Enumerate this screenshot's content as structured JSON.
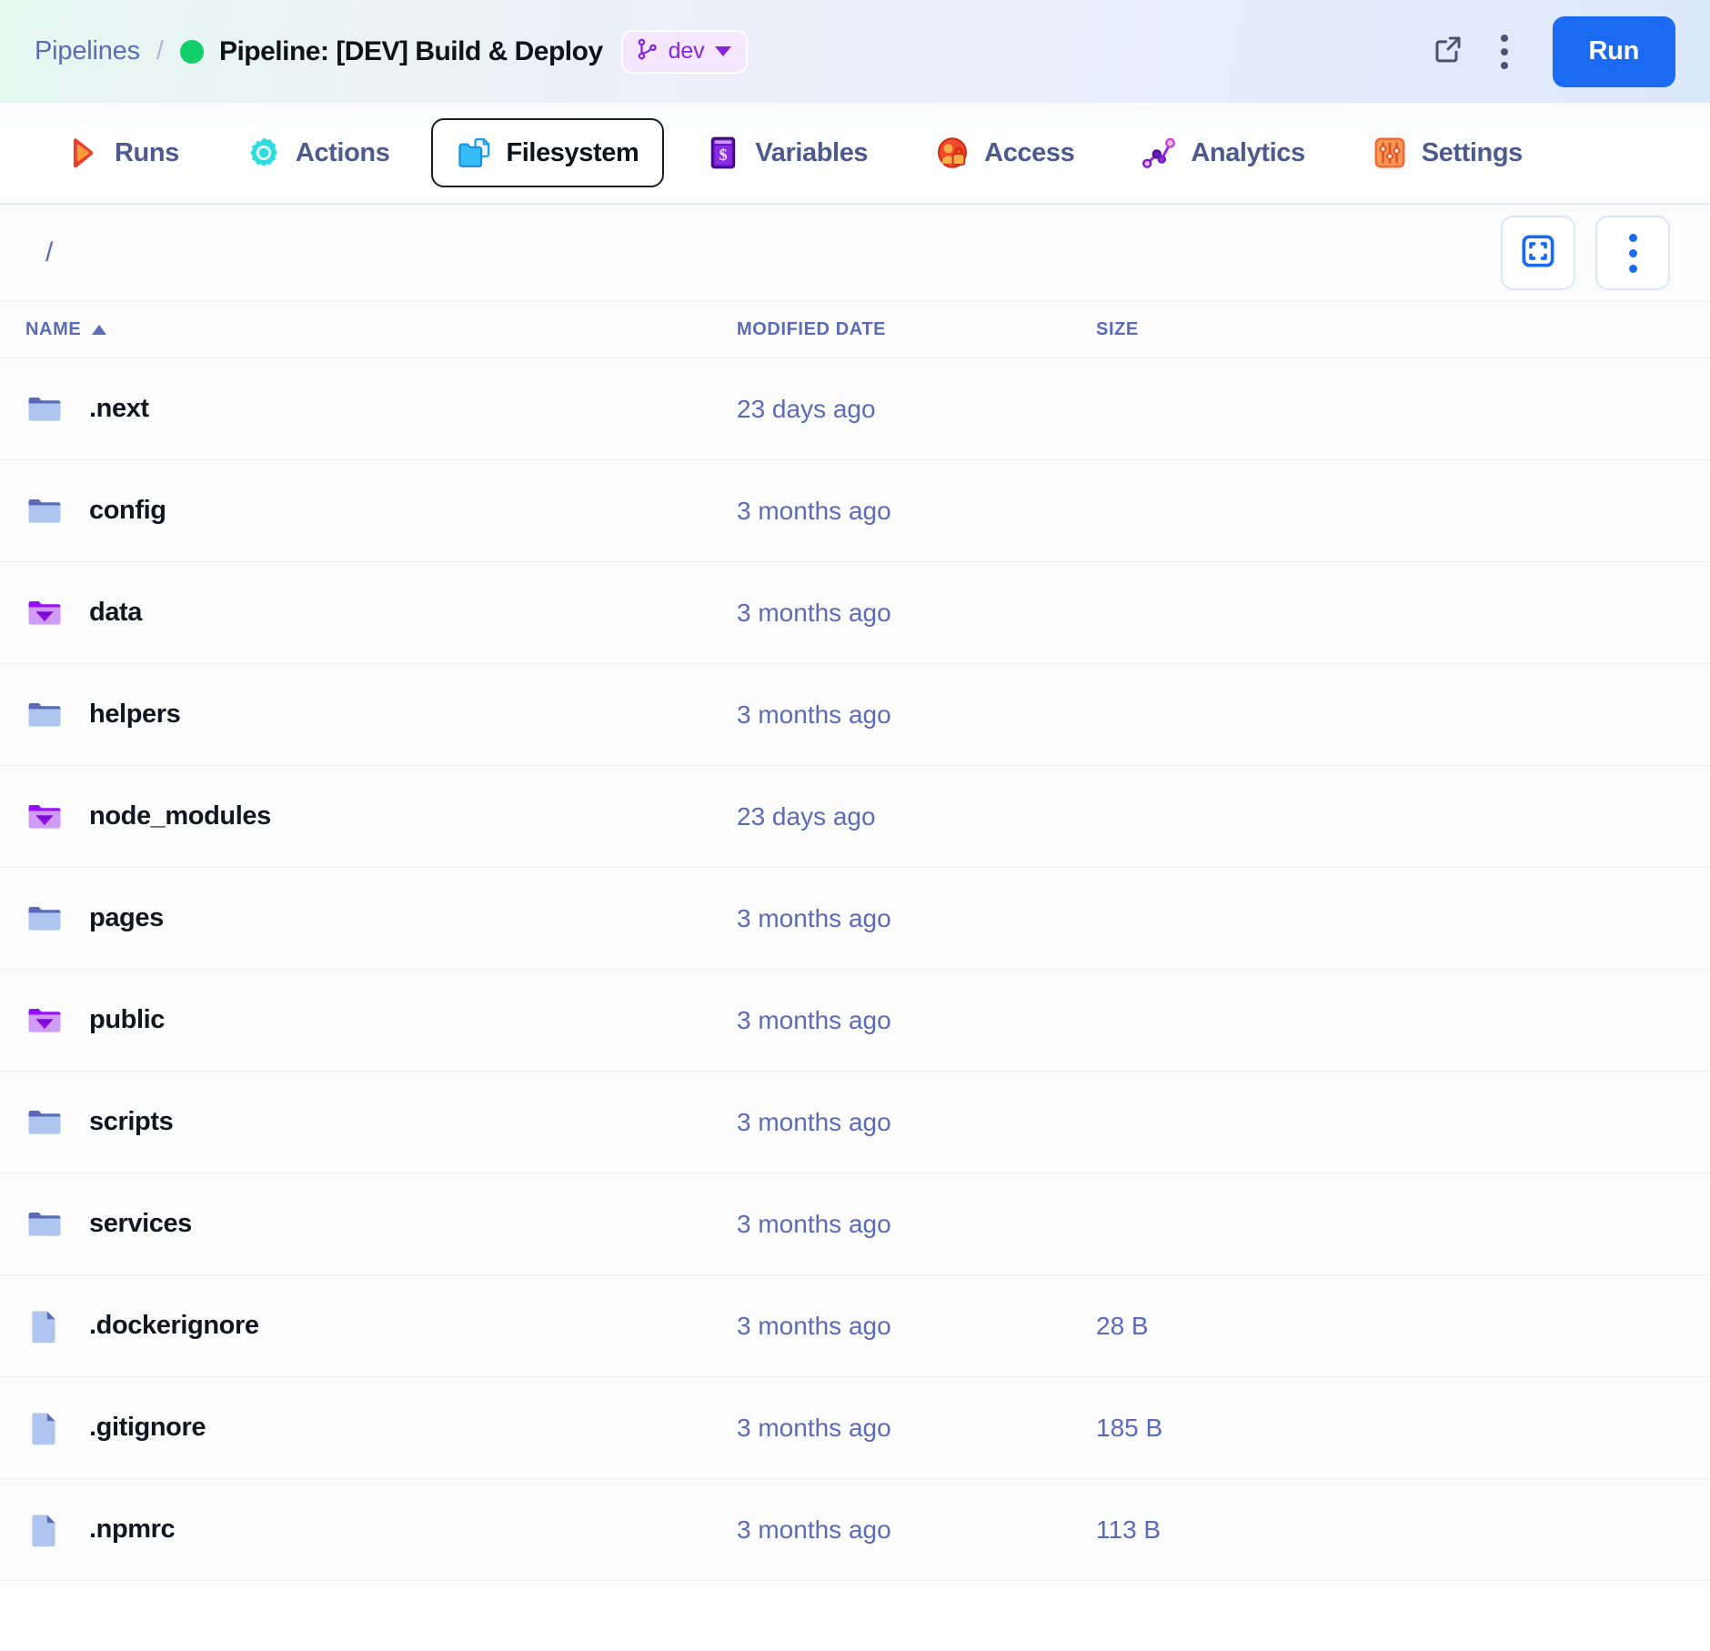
{
  "header": {
    "breadcrumb_root": "Pipelines",
    "breadcrumb_separator": "/",
    "status": "running",
    "title": "Pipeline: [DEV] Build & Deploy",
    "env_badge": {
      "label": "dev",
      "icon": "git-branch-icon"
    },
    "actions": {
      "open_external_icon": "external-link-icon",
      "more_icon": "kebab-menu-icon",
      "run_label": "Run"
    },
    "colors": {
      "accent": "#1a6bf2",
      "status_dot": "#12cf6a",
      "env_text": "#8426e0",
      "env_bg": "#f3e6fd"
    }
  },
  "tabs": [
    {
      "label": "Runs",
      "icon": "play-icon",
      "active": false
    },
    {
      "label": "Actions",
      "icon": "gear-icon",
      "active": false
    },
    {
      "label": "Filesystem",
      "icon": "folder-file-icon",
      "active": true
    },
    {
      "label": "Variables",
      "icon": "dollar-book-icon",
      "active": false
    },
    {
      "label": "Access",
      "icon": "user-lock-icon",
      "active": false
    },
    {
      "label": "Analytics",
      "icon": "graph-nodes-icon",
      "active": false
    },
    {
      "label": "Settings",
      "icon": "sliders-icon",
      "active": false
    }
  ],
  "toolbar": {
    "path": "/",
    "fullscreen_icon": "fullscreen-icon",
    "more_icon": "kebab-menu-icon"
  },
  "table": {
    "columns": [
      {
        "key": "name",
        "label": "NAME",
        "sorted": "asc"
      },
      {
        "key": "date",
        "label": "MODIFIED DATE",
        "sorted": null
      },
      {
        "key": "size",
        "label": "SIZE",
        "sorted": null
      }
    ],
    "rows": [
      {
        "name": ".next",
        "icon": "folder-icon",
        "date": "23 days ago",
        "size": ""
      },
      {
        "name": "config",
        "icon": "folder-icon",
        "date": "3 months ago",
        "size": ""
      },
      {
        "name": "data",
        "icon": "folder-gem-icon",
        "date": "3 months ago",
        "size": ""
      },
      {
        "name": "helpers",
        "icon": "folder-icon",
        "date": "3 months ago",
        "size": ""
      },
      {
        "name": "node_modules",
        "icon": "folder-gem-icon",
        "date": "23 days ago",
        "size": ""
      },
      {
        "name": "pages",
        "icon": "folder-icon",
        "date": "3 months ago",
        "size": ""
      },
      {
        "name": "public",
        "icon": "folder-gem-icon",
        "date": "3 months ago",
        "size": ""
      },
      {
        "name": "scripts",
        "icon": "folder-icon",
        "date": "3 months ago",
        "size": ""
      },
      {
        "name": "services",
        "icon": "folder-icon",
        "date": "3 months ago",
        "size": ""
      },
      {
        "name": ".dockerignore",
        "icon": "file-icon",
        "date": "3 months ago",
        "size": "28 B"
      },
      {
        "name": ".gitignore",
        "icon": "file-icon",
        "date": "3 months ago",
        "size": "185 B"
      },
      {
        "name": ".npmrc",
        "icon": "file-icon",
        "date": "3 months ago",
        "size": "113 B"
      }
    ]
  }
}
